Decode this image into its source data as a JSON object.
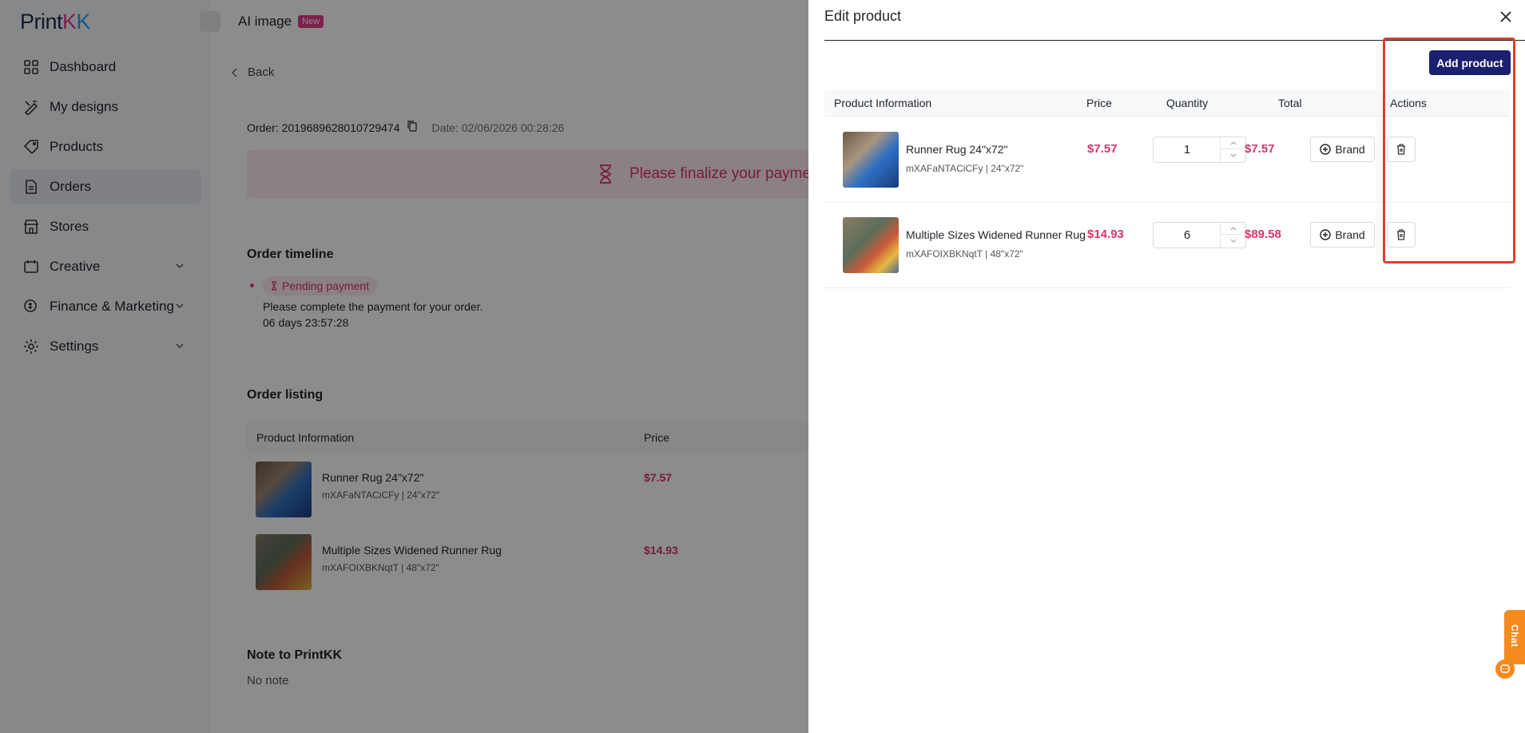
{
  "brand": {
    "logo_text": "PrintKK"
  },
  "sidebar": {
    "items": [
      {
        "label": "Dashboard",
        "icon": "dashboard-icon"
      },
      {
        "label": "My designs",
        "icon": "design-icon"
      },
      {
        "label": "Products",
        "icon": "tag-icon"
      },
      {
        "label": "Orders",
        "icon": "document-icon",
        "active": true
      },
      {
        "label": "Stores",
        "icon": "store-icon"
      },
      {
        "label": "Creative",
        "icon": "creative-icon",
        "expandable": true
      },
      {
        "label": "Finance & Marketing",
        "icon": "finance-icon",
        "expandable": true
      },
      {
        "label": "Settings",
        "icon": "gear-icon",
        "expandable": true
      }
    ]
  },
  "topbar": {
    "ai_label": "AI image",
    "new_badge": "New"
  },
  "order_page": {
    "back_label": "Back",
    "order_number": "Order: 2019689628010729474",
    "date": "Date: 02/06/2026 00:28:26",
    "banner_message": "Please finalize your payment",
    "timeline_title": "Order timeline",
    "timeline_status": "Pending payment",
    "timeline_text": "Please complete the payment for your order.",
    "timeline_countdown": "06 days 23:57:28",
    "listing_title": "Order listing",
    "listing_headers": {
      "product": "Product Information",
      "price": "Price"
    },
    "listing_items": [
      {
        "name": "Runner Rug 24\"x72\"",
        "sub": "mXAFaNTACiCFy | 24\"x72\"",
        "price": "$7.57"
      },
      {
        "name": "Multiple Sizes Widened Runner Rug",
        "sub": "mXAFOIXBKNqtT | 48\"x72\"",
        "price": "$14.93"
      }
    ],
    "note_title": "Note to PrintKK",
    "note_text": "No note"
  },
  "drawer": {
    "title": "Edit product",
    "add_button": "Add product",
    "headers": {
      "product": "Product Information",
      "price": "Price",
      "quantity": "Quantity",
      "total": "Total",
      "actions": "Actions"
    },
    "rows": [
      {
        "name": "Runner Rug 24\"x72\"",
        "sub": "mXAFaNTACiCFy | 24\"x72\"",
        "price": "$7.57",
        "quantity": "1",
        "total": "$7.57",
        "brand_label": "Brand"
      },
      {
        "name": "Multiple Sizes Widened Runner Rug",
        "sub": "mXAFOIXBKNqtT | 48\"x72\"",
        "price": "$14.93",
        "quantity": "6",
        "total": "$89.58",
        "brand_label": "Brand"
      }
    ]
  },
  "chat": {
    "label": "Chat"
  },
  "colors": {
    "accent_pink": "#d8346f",
    "primary_navy": "#1a1f6e",
    "highlight_red": "#d9412f",
    "chat_orange": "#f58a1f"
  }
}
